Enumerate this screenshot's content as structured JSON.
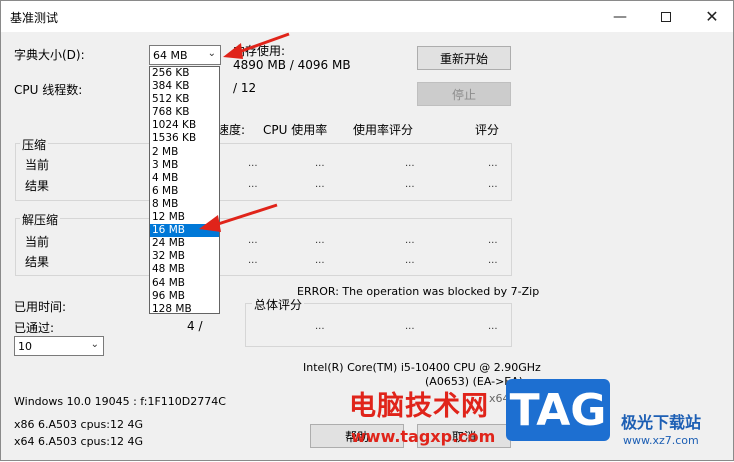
{
  "window": {
    "title": "基准测试",
    "minimize_icon": "minimize-icon",
    "maximize_icon": "maximize-icon",
    "close_icon": "close-icon"
  },
  "dictionary": {
    "label": "字典大小(D):",
    "selected": "64 MB",
    "options": [
      "256 KB",
      "384 KB",
      "512 KB",
      "768 KB",
      "1024 KB",
      "1536 KB",
      "2 MB",
      "3 MB",
      "4 MB",
      "6 MB",
      "8 MB",
      "12 MB",
      "16 MB",
      "24 MB",
      "32 MB",
      "48 MB",
      "64 MB",
      "96 MB",
      "128 MB"
    ],
    "highlighted": "16 MB"
  },
  "memory": {
    "label": "内存使用:",
    "value": "4890 MB / 4096 MB"
  },
  "threads": {
    "label": "CPU 线程数:",
    "value": "/ 12"
  },
  "buttons": {
    "restart": "重新开始",
    "stop": "停止",
    "help": "帮助",
    "cancel": "取消"
  },
  "columns": {
    "speed": "速度:",
    "cpu_usage": "CPU 使用率",
    "usage_rating": "使用率评分",
    "rating": "评分"
  },
  "compress": {
    "title": "压缩",
    "current": "当前",
    "result": "结果"
  },
  "decompress": {
    "title": "解压缩",
    "current": "当前",
    "result": "结果"
  },
  "dots": "...",
  "error_text": "ERROR: The operation was blocked by 7-Zip",
  "elapsed_label": "已用时间:",
  "passed_label": "已通过:",
  "passed_value": "4 /",
  "passes_select": "10",
  "total_rating_label": "总体评分",
  "cpu_info": {
    "line1": "Intel(R) Core(TM) i5-10400 CPU @ 2.90GHz",
    "line2": "(A0653) (EA->EA)",
    "line3": "x64"
  },
  "sys_info": {
    "os": "Windows 10.0 19045 : f:1F110D2774C",
    "x86": "x86 6.A503 cpus:12 4G",
    "x64": "x64 6.A503 cpus:12 4G"
  },
  "watermark": {
    "cn_text": "电脑技术网",
    "url": "www.tagxp.com",
    "tag": "TAG",
    "site_name": "极光下载站",
    "site_url": "www.xz7.com"
  },
  "colors": {
    "selection": "#0078d7",
    "annotation_arrow": "#e0241a",
    "watermark_red": "#e0241a",
    "tag_blue": "#1d6fd1"
  }
}
